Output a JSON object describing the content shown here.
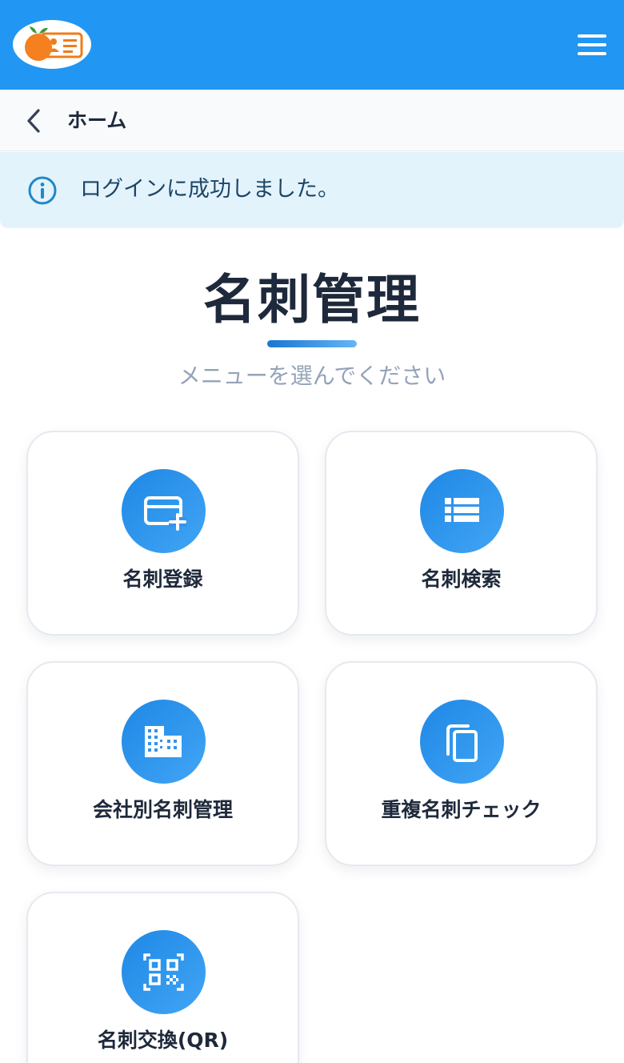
{
  "header": {
    "logo_icon": "business-card-orange-logo",
    "menu_icon": "hamburger-menu-icon",
    "color": "#2196f3"
  },
  "breadcrumb": {
    "back_icon": "chevron-left-icon",
    "title": "ホーム"
  },
  "alert": {
    "icon": "info-icon",
    "message": "ログインに成功しました。",
    "background": "#e3f3fc"
  },
  "main": {
    "title": "名刺管理",
    "subtitle": "メニューを選んでください"
  },
  "menu": {
    "items": [
      {
        "label": "名刺登録",
        "icon": "card-add-icon"
      },
      {
        "label": "名刺検索",
        "icon": "list-icon"
      },
      {
        "label": "会社別名刺管理",
        "icon": "building-icon"
      },
      {
        "label": "重複名刺チェック",
        "icon": "copy-icon"
      },
      {
        "label": "名刺交換(QR)",
        "icon": "qr-code-icon"
      }
    ]
  },
  "colors": {
    "accent": "#2196f3",
    "text": "#1e293b",
    "muted": "#94a3b8"
  }
}
